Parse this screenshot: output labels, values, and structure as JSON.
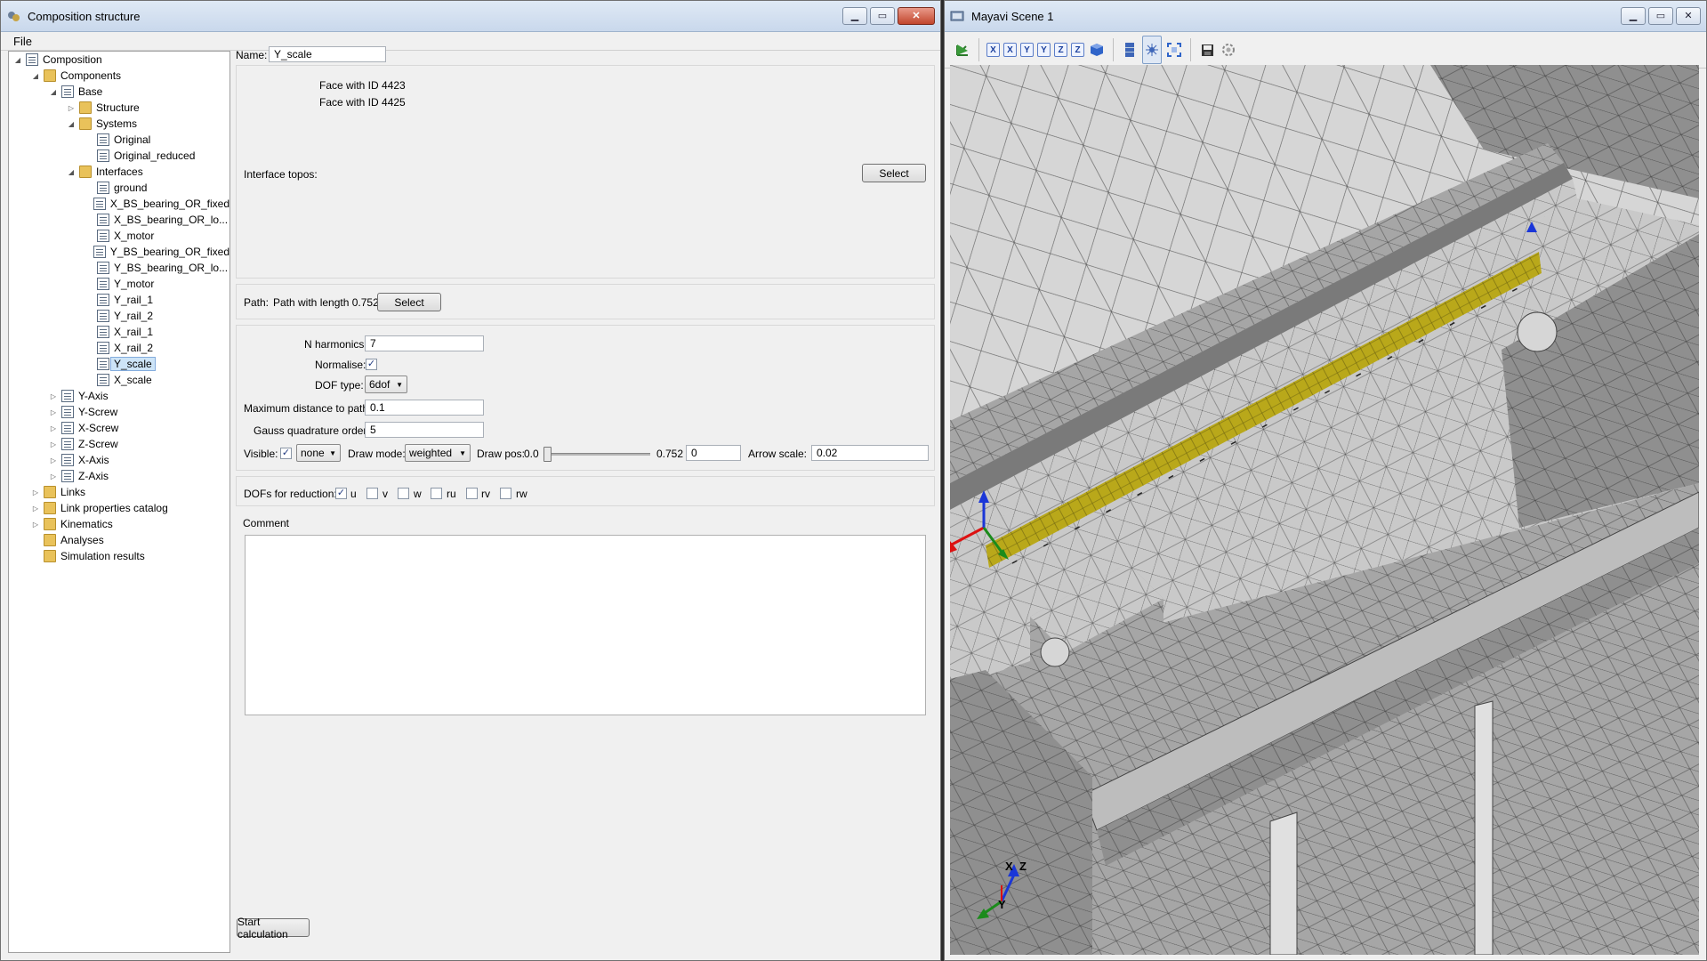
{
  "left_window": {
    "title": "Composition structure",
    "menu": [
      "File"
    ]
  },
  "tree": [
    {
      "label": "Composition",
      "level": 0,
      "expander": "open",
      "icon": "doc"
    },
    {
      "label": "Components",
      "level": 1,
      "expander": "open",
      "icon": "folder"
    },
    {
      "label": "Base",
      "level": 2,
      "expander": "open",
      "icon": "doc"
    },
    {
      "label": "Structure",
      "level": 3,
      "expander": "closed",
      "icon": "folder"
    },
    {
      "label": "Systems",
      "level": 3,
      "expander": "open",
      "icon": "folder"
    },
    {
      "label": "Original",
      "level": 4,
      "expander": "none",
      "icon": "doc"
    },
    {
      "label": "Original_reduced",
      "level": 4,
      "expander": "none",
      "icon": "doc"
    },
    {
      "label": "Interfaces",
      "level": 3,
      "expander": "open",
      "icon": "folder"
    },
    {
      "label": "ground",
      "level": 4,
      "expander": "none",
      "icon": "doc"
    },
    {
      "label": "X_BS_bearing_OR_fixed",
      "level": 4,
      "expander": "none",
      "icon": "doc"
    },
    {
      "label": "X_BS_bearing_OR_lo...",
      "level": 4,
      "expander": "none",
      "icon": "doc"
    },
    {
      "label": "X_motor",
      "level": 4,
      "expander": "none",
      "icon": "doc"
    },
    {
      "label": "Y_BS_bearing_OR_fixed",
      "level": 4,
      "expander": "none",
      "icon": "doc"
    },
    {
      "label": "Y_BS_bearing_OR_lo...",
      "level": 4,
      "expander": "none",
      "icon": "doc"
    },
    {
      "label": "Y_motor",
      "level": 4,
      "expander": "none",
      "icon": "doc"
    },
    {
      "label": "Y_rail_1",
      "level": 4,
      "expander": "none",
      "icon": "doc"
    },
    {
      "label": "Y_rail_2",
      "level": 4,
      "expander": "none",
      "icon": "doc"
    },
    {
      "label": "X_rail_1",
      "level": 4,
      "expander": "none",
      "icon": "doc"
    },
    {
      "label": "X_rail_2",
      "level": 4,
      "expander": "none",
      "icon": "doc"
    },
    {
      "label": "Y_scale",
      "level": 4,
      "expander": "none",
      "icon": "doc",
      "selected": true
    },
    {
      "label": "X_scale",
      "level": 4,
      "expander": "none",
      "icon": "doc"
    },
    {
      "label": "Y-Axis",
      "level": 2,
      "expander": "closed",
      "icon": "doc"
    },
    {
      "label": "Y-Screw",
      "level": 2,
      "expander": "closed",
      "icon": "doc"
    },
    {
      "label": "X-Screw",
      "level": 2,
      "expander": "closed",
      "icon": "doc"
    },
    {
      "label": "Z-Screw",
      "level": 2,
      "expander": "closed",
      "icon": "doc"
    },
    {
      "label": "X-Axis",
      "level": 2,
      "expander": "closed",
      "icon": "doc"
    },
    {
      "label": "Z-Axis",
      "level": 2,
      "expander": "closed",
      "icon": "doc"
    },
    {
      "label": "Links",
      "level": 1,
      "expander": "closed",
      "icon": "folder"
    },
    {
      "label": "Link properties catalog",
      "level": 1,
      "expander": "closed",
      "icon": "folder"
    },
    {
      "label": "Kinematics",
      "level": 1,
      "expander": "closed",
      "icon": "folder"
    },
    {
      "label": "Analyses",
      "level": 1,
      "expander": "none",
      "icon": "folder"
    },
    {
      "label": "Simulation results",
      "level": 1,
      "expander": "none",
      "icon": "folder"
    }
  ],
  "form": {
    "name_label": "Name:",
    "name_value": "Y_scale",
    "faces": [
      "Face with ID 4423",
      "Face with ID 4425"
    ],
    "interface_topos_label": "Interface topos:",
    "select_label": "Select",
    "path_label": "Path:",
    "path_value": "Path with length 0.752",
    "n_harmonics_label": "N harmonics:",
    "n_harmonics_value": "7",
    "normalise_label": "Normalise:",
    "normalise_checked": true,
    "dof_type_label": "DOF type:",
    "dof_type_value": "6dof",
    "max_distance_label": "Maximum distance to path:",
    "max_distance_value": "0.1",
    "gauss_order_label": "Gauss quadrature order:",
    "gauss_order_value": "5",
    "visible_label": "Visible:",
    "visible_checked": true,
    "visible_combo": "none",
    "draw_mode_label": "Draw mode:",
    "draw_mode_value": "weighted",
    "draw_pos_label": "Draw pos:",
    "draw_pos_min": "0.0",
    "draw_pos_max": "0.752",
    "draw_pos_value": "0",
    "arrow_scale_label": "Arrow scale:",
    "arrow_scale_value": "0.02",
    "dofs_label": "DOFs for reduction:",
    "dofs": [
      {
        "label": "u",
        "checked": true
      },
      {
        "label": "v",
        "checked": false
      },
      {
        "label": "w",
        "checked": false
      },
      {
        "label": "ru",
        "checked": false
      },
      {
        "label": "rv",
        "checked": false
      },
      {
        "label": "rw",
        "checked": false
      }
    ],
    "comment_label": "Comment",
    "comment_value": "",
    "start_label": "Start calculation"
  },
  "right_window": {
    "title": "Mayavi Scene 1",
    "toolbar": [
      "isometric-view",
      "view-x-minus",
      "view-x-plus",
      "view-y-minus",
      "view-y-plus",
      "view-z-minus",
      "view-z-plus",
      "view-iso",
      "parallel-projection",
      "pipeline-editor",
      "full-screen",
      "save-snapshot",
      "configure-scene"
    ],
    "toolbar_glyphs": {
      "x": "X",
      "y": "Y",
      "z": "Z"
    },
    "axes_labels": {
      "x": "X",
      "y": "Y",
      "z": "Z"
    }
  },
  "colors": {
    "selection_bg": "#cde4f7",
    "folder": "#e9c25a",
    "scale_band": "#b9a81a",
    "mesh_light": "#d9d9d9",
    "mesh_dark": "#8e8e8e"
  }
}
